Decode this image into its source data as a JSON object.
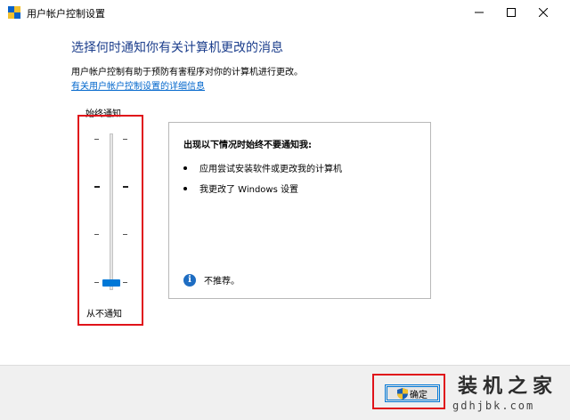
{
  "window": {
    "title": "用户帐户控制设置",
    "controls": {
      "minimize": "minimize-icon",
      "maximize": "maximize-icon",
      "close": "close-icon"
    }
  },
  "main": {
    "heading": "选择何时通知你有关计算机更改的消息",
    "description": "用户帐户控制有助于预防有害程序对你的计算机进行更改。",
    "link": "有关用户帐户控制设置的详细信息"
  },
  "slider": {
    "top_label": "始终通知",
    "bottom_label": "从不通知",
    "levels": 4,
    "selected_level": 1,
    "selected_level_note": "lowest position (Never notify)"
  },
  "panel": {
    "heading": "出现以下情况时始终不要通知我:",
    "bullets": [
      "应用尝试安装软件或更改我的计算机",
      "我更改了 Windows 设置"
    ],
    "note": "不推荐。"
  },
  "footer": {
    "ok_label": "确定"
  },
  "watermark": {
    "text": "装机之家",
    "url": "gdhjbk.com"
  },
  "colors": {
    "heading": "#1c3e8c",
    "link": "#0066cc",
    "slider_thumb": "#0078d7",
    "highlight_box": "#e0131a",
    "info_icon": "#1e6dc2"
  }
}
